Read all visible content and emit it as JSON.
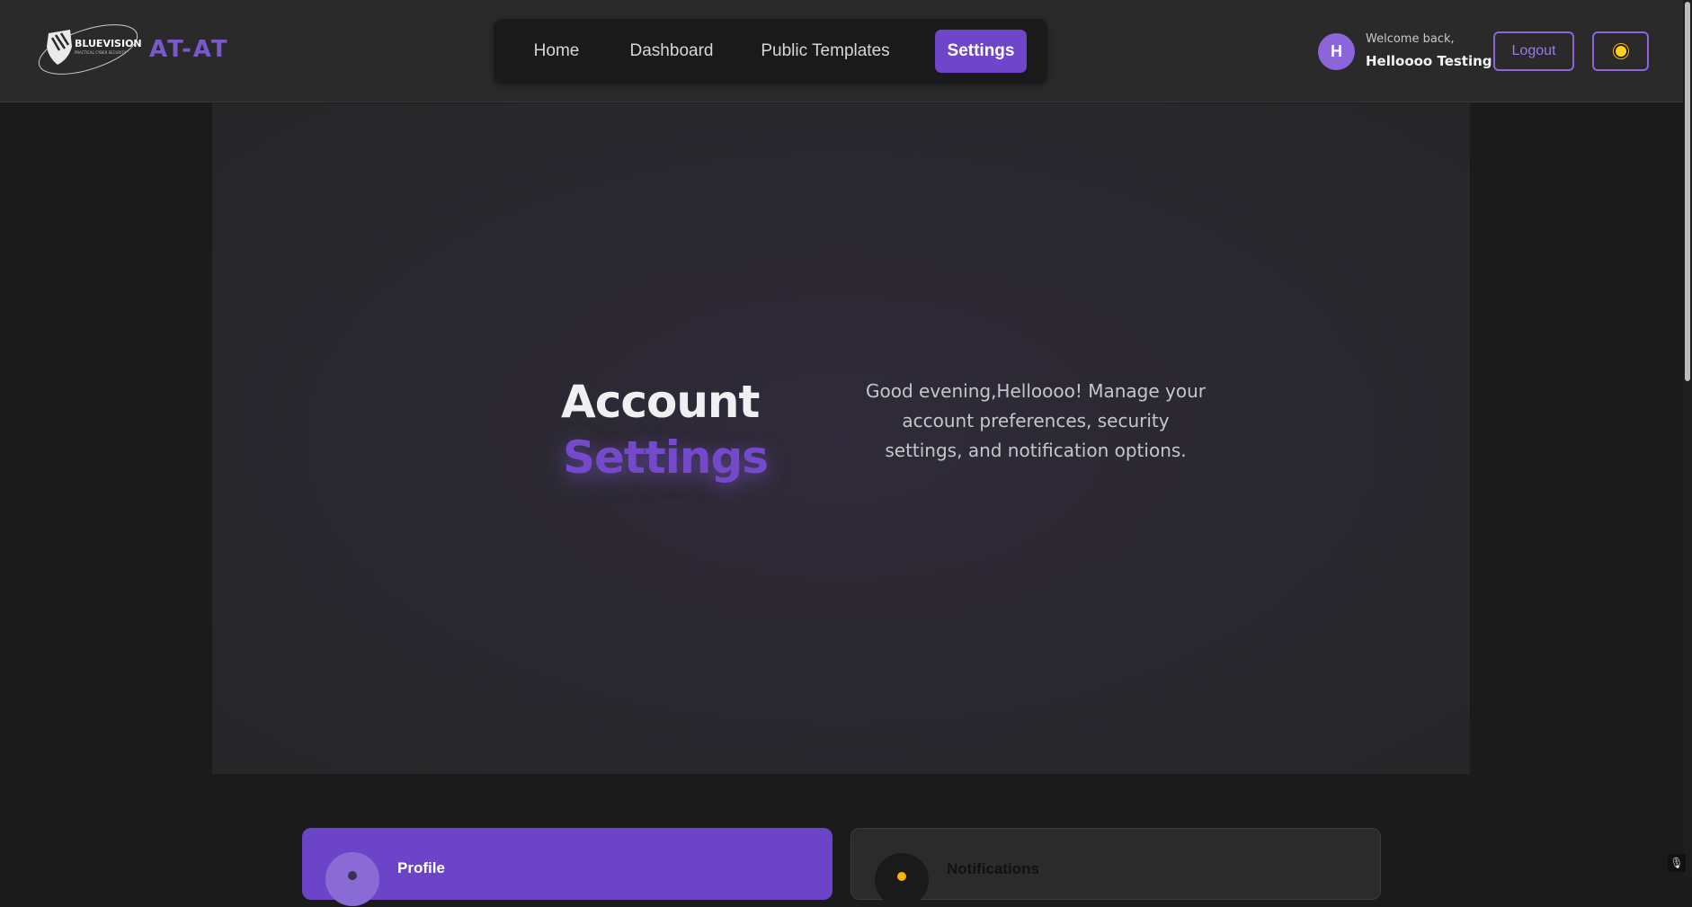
{
  "header": {
    "logo_text": "BLUEVISION",
    "logo_tagline": "PRACTICAL CYBER SECURITY",
    "brand": "AT-AT",
    "nav": [
      {
        "label": "Home"
      },
      {
        "label": "Dashboard"
      },
      {
        "label": "Public Templates"
      },
      {
        "label": "Settings",
        "active": true
      }
    ],
    "user": {
      "avatar_initial": "H",
      "welcome": "Welcome back,",
      "name": "Helloooo Testing"
    },
    "logout_label": "Logout",
    "theme_icon": "sun-icon"
  },
  "hero": {
    "title_line1": "Account",
    "title_line2": "Settings",
    "description": "Good evening,Helloooo! Manage your account preferences, security settings, and notification options."
  },
  "cards": [
    {
      "label": "Profile",
      "icon": "user-icon"
    },
    {
      "label": "Notifications",
      "icon": "bell-icon"
    }
  ],
  "colors": {
    "accent": "#6f45c9",
    "background": "#1b1b1c",
    "header": "#2a2a2b"
  }
}
